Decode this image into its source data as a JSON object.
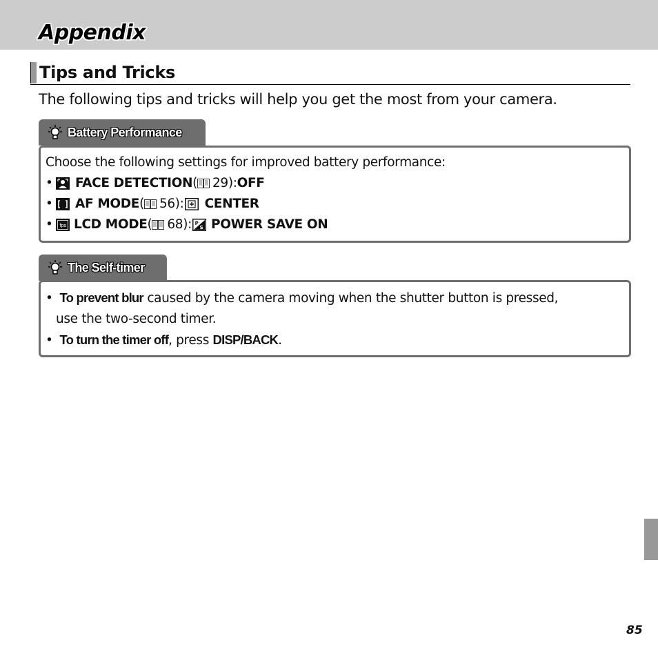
{
  "header": {
    "title": "Appendix"
  },
  "section": {
    "title": "Tips and Tricks",
    "intro": "The following tips and tricks will help you get the most from your camera."
  },
  "battery": {
    "tab_icon": "lightbulb-icon",
    "tab_label": "Battery Performance",
    "lead": "Choose the following settings for improved battery performance:",
    "items": [
      {
        "icon": "face-detection-icon",
        "label": "FACE DETECTION",
        "ref_icon": "book-icon",
        "page": "29",
        "value_icon": "",
        "value": "OFF"
      },
      {
        "icon": "af-mode-icon",
        "label": "AF MODE",
        "ref_icon": "book-icon",
        "page": "56",
        "value_icon": "center-af-icon",
        "value": "CENTER"
      },
      {
        "icon": "lcd-mode-fps-icon",
        "label": "LCD MODE",
        "ref_icon": "book-icon",
        "page": "68",
        "value_icon": "power-save-icon",
        "value": "POWER SAVE ON"
      }
    ]
  },
  "selftimer": {
    "tab_icon": "lightbulb-icon",
    "tab_label": "The Self-timer",
    "items": [
      {
        "bold": "To prevent blur",
        "text": " caused by the camera moving when the shutter button is pressed,",
        "text2": "use the two-second timer."
      },
      {
        "bold": "To turn the timer off",
        "text": ", press ",
        "bold2": "DISP/BACK",
        "text2": "."
      }
    ]
  },
  "punct": {
    "open": " (",
    "close": "): ",
    "bullet": "•"
  },
  "footer": {
    "page_number": "85"
  }
}
